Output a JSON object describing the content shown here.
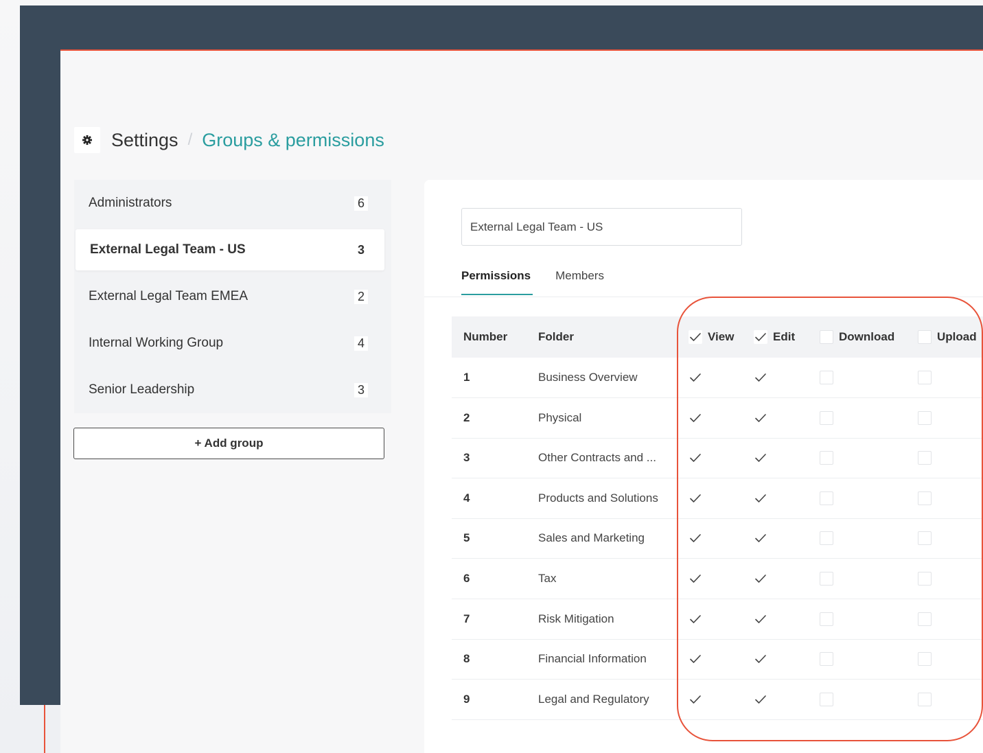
{
  "breadcrumb": {
    "root": "Settings",
    "separator": "/",
    "current": "Groups & permissions"
  },
  "groups": [
    {
      "name": "Administrators",
      "count": "6",
      "selected": false
    },
    {
      "name": "External Legal Team - US",
      "count": "3",
      "selected": true
    },
    {
      "name": "External Legal Team EMEA",
      "count": "2",
      "selected": false
    },
    {
      "name": "Internal Working Group",
      "count": "4",
      "selected": false
    },
    {
      "name": "Senior Leadership",
      "count": "3",
      "selected": false
    }
  ],
  "add_group_label": "+ Add group",
  "editor": {
    "group_name_value": "External Legal Team - US",
    "tabs": [
      {
        "label": "Permissions",
        "active": true
      },
      {
        "label": "Members",
        "active": false
      }
    ]
  },
  "table": {
    "headers": {
      "number": "Number",
      "folder": "Folder",
      "view": "View",
      "edit": "Edit",
      "download": "Download",
      "upload": "Upload"
    },
    "header_checks": {
      "view": true,
      "edit": true,
      "download": false,
      "upload": false
    },
    "rows": [
      {
        "number": "1",
        "folder": "Business Overview",
        "view": true,
        "edit": true,
        "download": false,
        "upload": false
      },
      {
        "number": "2",
        "folder": "Physical",
        "view": true,
        "edit": true,
        "download": false,
        "upload": false
      },
      {
        "number": "3",
        "folder": "Other Contracts and ...",
        "view": true,
        "edit": true,
        "download": false,
        "upload": false
      },
      {
        "number": "4",
        "folder": "Products and Solutions",
        "view": true,
        "edit": true,
        "download": false,
        "upload": false
      },
      {
        "number": "5",
        "folder": "Sales and Marketing",
        "view": true,
        "edit": true,
        "download": false,
        "upload": false
      },
      {
        "number": "6",
        "folder": "Tax",
        "view": true,
        "edit": true,
        "download": false,
        "upload": false
      },
      {
        "number": "7",
        "folder": "Risk Mitigation",
        "view": true,
        "edit": true,
        "download": false,
        "upload": false
      },
      {
        "number": "8",
        "folder": "Financial Information",
        "view": true,
        "edit": true,
        "download": false,
        "upload": false
      },
      {
        "number": "9",
        "folder": "Legal and Regulatory",
        "view": true,
        "edit": true,
        "download": false,
        "upload": false
      }
    ]
  },
  "colors": {
    "accent": "#e8533a",
    "teal": "#2a9d9f",
    "nav_dark": "#3a4a5a"
  },
  "icons": {
    "breadcrumb": "gear-icon",
    "checked": "checkmark-icon"
  }
}
